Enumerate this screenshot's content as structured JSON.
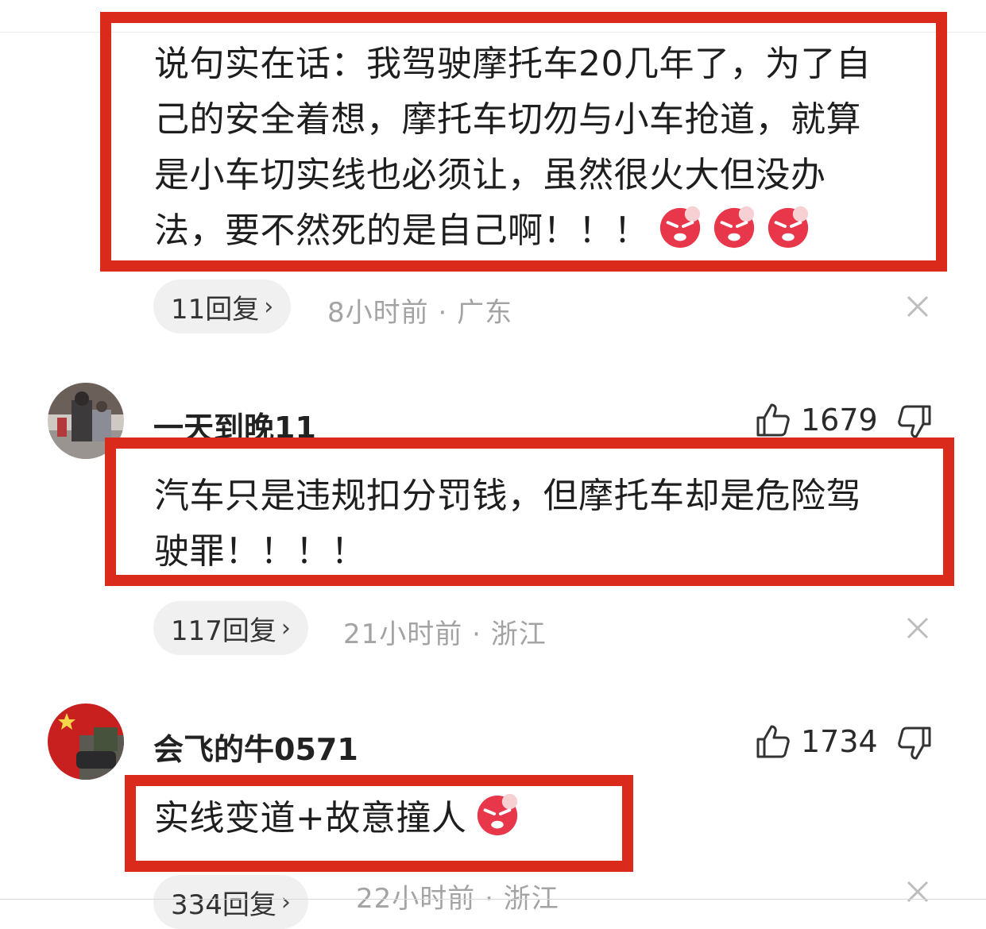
{
  "comment1": {
    "lines": [
      "说句实在话：我驾驶摩托车20几年了，为了自",
      "己的安全着想，摩托车切勿与小车抢道，就算",
      "是小车切实线也必须让，虽然很火大但没办",
      "法，要不然死的是自己啊！！！"
    ],
    "emoji": "angry-emoji",
    "reply_label": "11回复",
    "time": "8小时前",
    "location": "广东",
    "separator": "·"
  },
  "comment2": {
    "username": "一天到晚11",
    "likes": "1679",
    "lines": [
      "汽车只是违规扣分罚钱，但摩托车却是危险驾",
      "驶罪！！！！"
    ],
    "reply_label": "117回复",
    "time": "21小时前",
    "location": "浙江",
    "separator": "·"
  },
  "comment3": {
    "username": "会飞的牛0571",
    "likes": "1734",
    "lines": [
      "实线变道+故意撞人"
    ],
    "emoji": "angry-emoji",
    "reply_label": "334回复",
    "time": "22小时前",
    "location": "浙江",
    "separator": "·"
  },
  "colors": {
    "highlight": "#d92a1c",
    "meta": "#a3a3a3",
    "pill": "#f0f0f0"
  },
  "icons": [
    "thumbs-up-icon",
    "thumbs-down-icon",
    "close-icon",
    "chevron-right-icon",
    "angry-emoji"
  ]
}
